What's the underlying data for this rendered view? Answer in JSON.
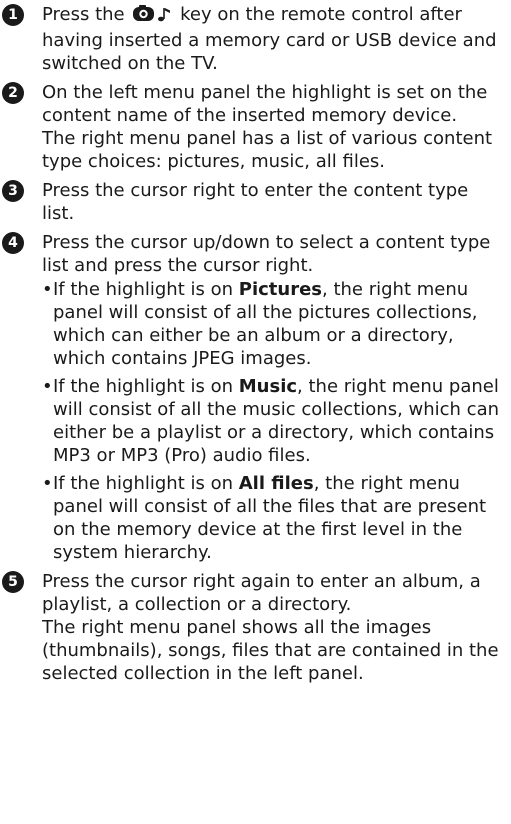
{
  "steps": [
    {
      "number": "1",
      "text_before_icon": "Press the",
      "icon": "camera-music-key-icon",
      "text_after_icon": "key on the remote control after having inserted a memory card or USB device and switched on the TV."
    },
    {
      "number": "2",
      "paragraph1": "On the left menu panel the highlight is set on the content name of the inserted memory device.",
      "paragraph2": "The right menu panel has a list of various content type choices: pictures, music, all files."
    },
    {
      "number": "3",
      "text": "Press the cursor right to enter the content type list."
    },
    {
      "number": "4",
      "text": "Press the cursor up/down to select a content type list and press the cursor right.",
      "bullets": [
        {
          "bullet": "•",
          "prefix": "If the highlight is on",
          "keyword": "Pictures",
          "text": ", the right menu panel will consist of all the pictures collections, which can either be an album or a directory, which contains JPEG images."
        },
        {
          "bullet": "•",
          "prefix": "If the highlight is on",
          "keyword": "Music",
          "text": ", the right menu panel will consist of all the music collections, which can either be a playlist or a directory, which contains MP3 or MP3 (Pro) audio files."
        },
        {
          "bullet": "•",
          "prefix": "If the highlight is on",
          "keyword": "All files",
          "text": ", the right menu panel will consist of all the files that are present on the memory device at the first level in the system hierarchy."
        }
      ]
    },
    {
      "number": "5",
      "paragraph1": "Press the cursor right again to enter an album, a playlist, a collection or a directory.",
      "paragraph2": "The right menu panel shows all the images (thumbnails), songs, files that are contained in the selected collection in the left panel."
    }
  ]
}
